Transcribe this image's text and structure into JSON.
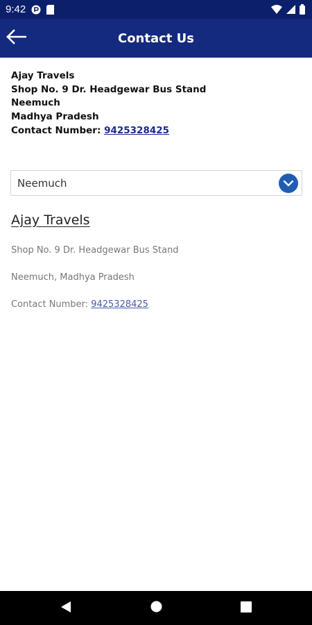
{
  "status_bar": {
    "time": "9:42",
    "icons": [
      "data-saver-icon",
      "sim-card-icon",
      "wifi-icon",
      "signal-icon",
      "battery-icon"
    ]
  },
  "app_bar": {
    "title": "Contact Us",
    "back_icon": "arrow-left-icon",
    "color": "#142a7e"
  },
  "address": {
    "name": "Ajay Travels",
    "line1": "Shop No. 9 Dr. Headgewar Bus Stand",
    "city": "Neemuch",
    "state": "Madhya Pradesh",
    "contact_label": "Contact Number: ",
    "phone": "9425328425"
  },
  "city_select": {
    "selected": "Neemuch",
    "icon": "chevron-down-icon",
    "accent": "#1f5cb3"
  },
  "office": {
    "name": "Ajay Travels",
    "line1": "Shop No. 9 Dr. Headgewar Bus Stand",
    "city_state": "Neemuch, Madhya Pradesh",
    "contact_label": "Contact Number: ",
    "phone": "9425328425"
  },
  "nav_bar": {
    "icons": [
      "back-triangle-icon",
      "home-circle-icon",
      "recents-square-icon"
    ]
  }
}
